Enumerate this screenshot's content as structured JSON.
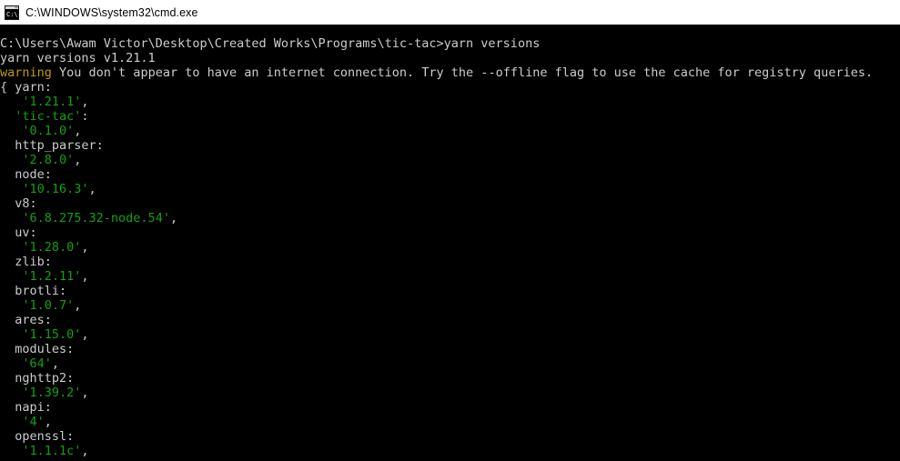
{
  "window": {
    "title": "C:\\WINDOWS\\system32\\cmd.exe",
    "icon": "cmd-console-icon",
    "titlebar_bg": "#ffffff",
    "titlebar_fg": "#000000",
    "console_bg": "#000000",
    "console_fg": "#cccccc"
  },
  "colors": {
    "white": "#cccccc",
    "green": "#13a10e",
    "yellow": "#c19c00",
    "background": "#000000"
  },
  "terminal": {
    "prompt_path": "C:\\Users\\Awam Victor\\Desktop\\Created Works\\Programs\\tic-tac",
    "prompt_symbol": ">",
    "command": "yarn versions",
    "banner": "yarn versions v1.21.1",
    "warning_label": "warning",
    "warning_text": " You don't appear to have an internet connection. Try the --offline flag to use the cache for registry queries.",
    "open_brace": "{ ",
    "lines": [
      {
        "segments": [
          {
            "text": "C:\\Users\\Awam Victor\\Desktop\\Created Works\\Programs\\tic-tac>yarn versions",
            "color": "white"
          }
        ]
      },
      {
        "segments": [
          {
            "text": "yarn versions v1.21.1",
            "color": "white"
          }
        ]
      },
      {
        "segments": [
          {
            "text": "warning",
            "color": "yellow"
          },
          {
            "text": " You don't appear to have an internet connection. Try the --offline flag to use the cache for registry queries.",
            "color": "white"
          }
        ]
      },
      {
        "segments": [
          {
            "text": "{ yarn:",
            "color": "white"
          }
        ]
      },
      {
        "segments": [
          {
            "text": "   ",
            "color": "white"
          },
          {
            "text": "'1.21.1'",
            "color": "green"
          },
          {
            "text": ",",
            "color": "white"
          }
        ]
      },
      {
        "segments": [
          {
            "text": "  ",
            "color": "white"
          },
          {
            "text": "'tic-tac'",
            "color": "green"
          },
          {
            "text": ":",
            "color": "white"
          }
        ]
      },
      {
        "segments": [
          {
            "text": "   ",
            "color": "white"
          },
          {
            "text": "'0.1.0'",
            "color": "green"
          },
          {
            "text": ",",
            "color": "white"
          }
        ]
      },
      {
        "segments": [
          {
            "text": "  http_parser:",
            "color": "white"
          }
        ]
      },
      {
        "segments": [
          {
            "text": "   ",
            "color": "white"
          },
          {
            "text": "'2.8.0'",
            "color": "green"
          },
          {
            "text": ",",
            "color": "white"
          }
        ]
      },
      {
        "segments": [
          {
            "text": "  node:",
            "color": "white"
          }
        ]
      },
      {
        "segments": [
          {
            "text": "   ",
            "color": "white"
          },
          {
            "text": "'10.16.3'",
            "color": "green"
          },
          {
            "text": ",",
            "color": "white"
          }
        ]
      },
      {
        "segments": [
          {
            "text": "  v8:",
            "color": "white"
          }
        ]
      },
      {
        "segments": [
          {
            "text": "   ",
            "color": "white"
          },
          {
            "text": "'6.8.275.32-node.54'",
            "color": "green"
          },
          {
            "text": ",",
            "color": "white"
          }
        ]
      },
      {
        "segments": [
          {
            "text": "  uv:",
            "color": "white"
          }
        ]
      },
      {
        "segments": [
          {
            "text": "   ",
            "color": "white"
          },
          {
            "text": "'1.28.0'",
            "color": "green"
          },
          {
            "text": ",",
            "color": "white"
          }
        ]
      },
      {
        "segments": [
          {
            "text": "  zlib:",
            "color": "white"
          }
        ]
      },
      {
        "segments": [
          {
            "text": "   ",
            "color": "white"
          },
          {
            "text": "'1.2.11'",
            "color": "green"
          },
          {
            "text": ",",
            "color": "white"
          }
        ]
      },
      {
        "segments": [
          {
            "text": "  brotli:",
            "color": "white"
          }
        ]
      },
      {
        "segments": [
          {
            "text": "   ",
            "color": "white"
          },
          {
            "text": "'1.0.7'",
            "color": "green"
          },
          {
            "text": ",",
            "color": "white"
          }
        ]
      },
      {
        "segments": [
          {
            "text": "  ares:",
            "color": "white"
          }
        ]
      },
      {
        "segments": [
          {
            "text": "   ",
            "color": "white"
          },
          {
            "text": "'1.15.0'",
            "color": "green"
          },
          {
            "text": ",",
            "color": "white"
          }
        ]
      },
      {
        "segments": [
          {
            "text": "  modules:",
            "color": "white"
          }
        ]
      },
      {
        "segments": [
          {
            "text": "   ",
            "color": "white"
          },
          {
            "text": "'64'",
            "color": "green"
          },
          {
            "text": ",",
            "color": "white"
          }
        ]
      },
      {
        "segments": [
          {
            "text": "  nghttp2:",
            "color": "white"
          }
        ]
      },
      {
        "segments": [
          {
            "text": "   ",
            "color": "white"
          },
          {
            "text": "'1.39.2'",
            "color": "green"
          },
          {
            "text": ",",
            "color": "white"
          }
        ]
      },
      {
        "segments": [
          {
            "text": "  napi:",
            "color": "white"
          }
        ]
      },
      {
        "segments": [
          {
            "text": "   ",
            "color": "white"
          },
          {
            "text": "'4'",
            "color": "green"
          },
          {
            "text": ",",
            "color": "white"
          }
        ]
      },
      {
        "segments": [
          {
            "text": "  openssl:",
            "color": "white"
          }
        ]
      },
      {
        "segments": [
          {
            "text": "   ",
            "color": "white"
          },
          {
            "text": "'1.1.1c'",
            "color": "green"
          },
          {
            "text": ",",
            "color": "white"
          }
        ]
      }
    ],
    "versions": {
      "yarn": "1.21.1",
      "tic-tac": "0.1.0",
      "http_parser": "2.8.0",
      "node": "10.16.3",
      "v8": "6.8.275.32-node.54",
      "uv": "1.28.0",
      "zlib": "1.2.11",
      "brotli": "1.0.7",
      "ares": "1.15.0",
      "modules": "64",
      "nghttp2": "1.39.2",
      "napi": "4",
      "openssl": "1.1.1c"
    }
  }
}
